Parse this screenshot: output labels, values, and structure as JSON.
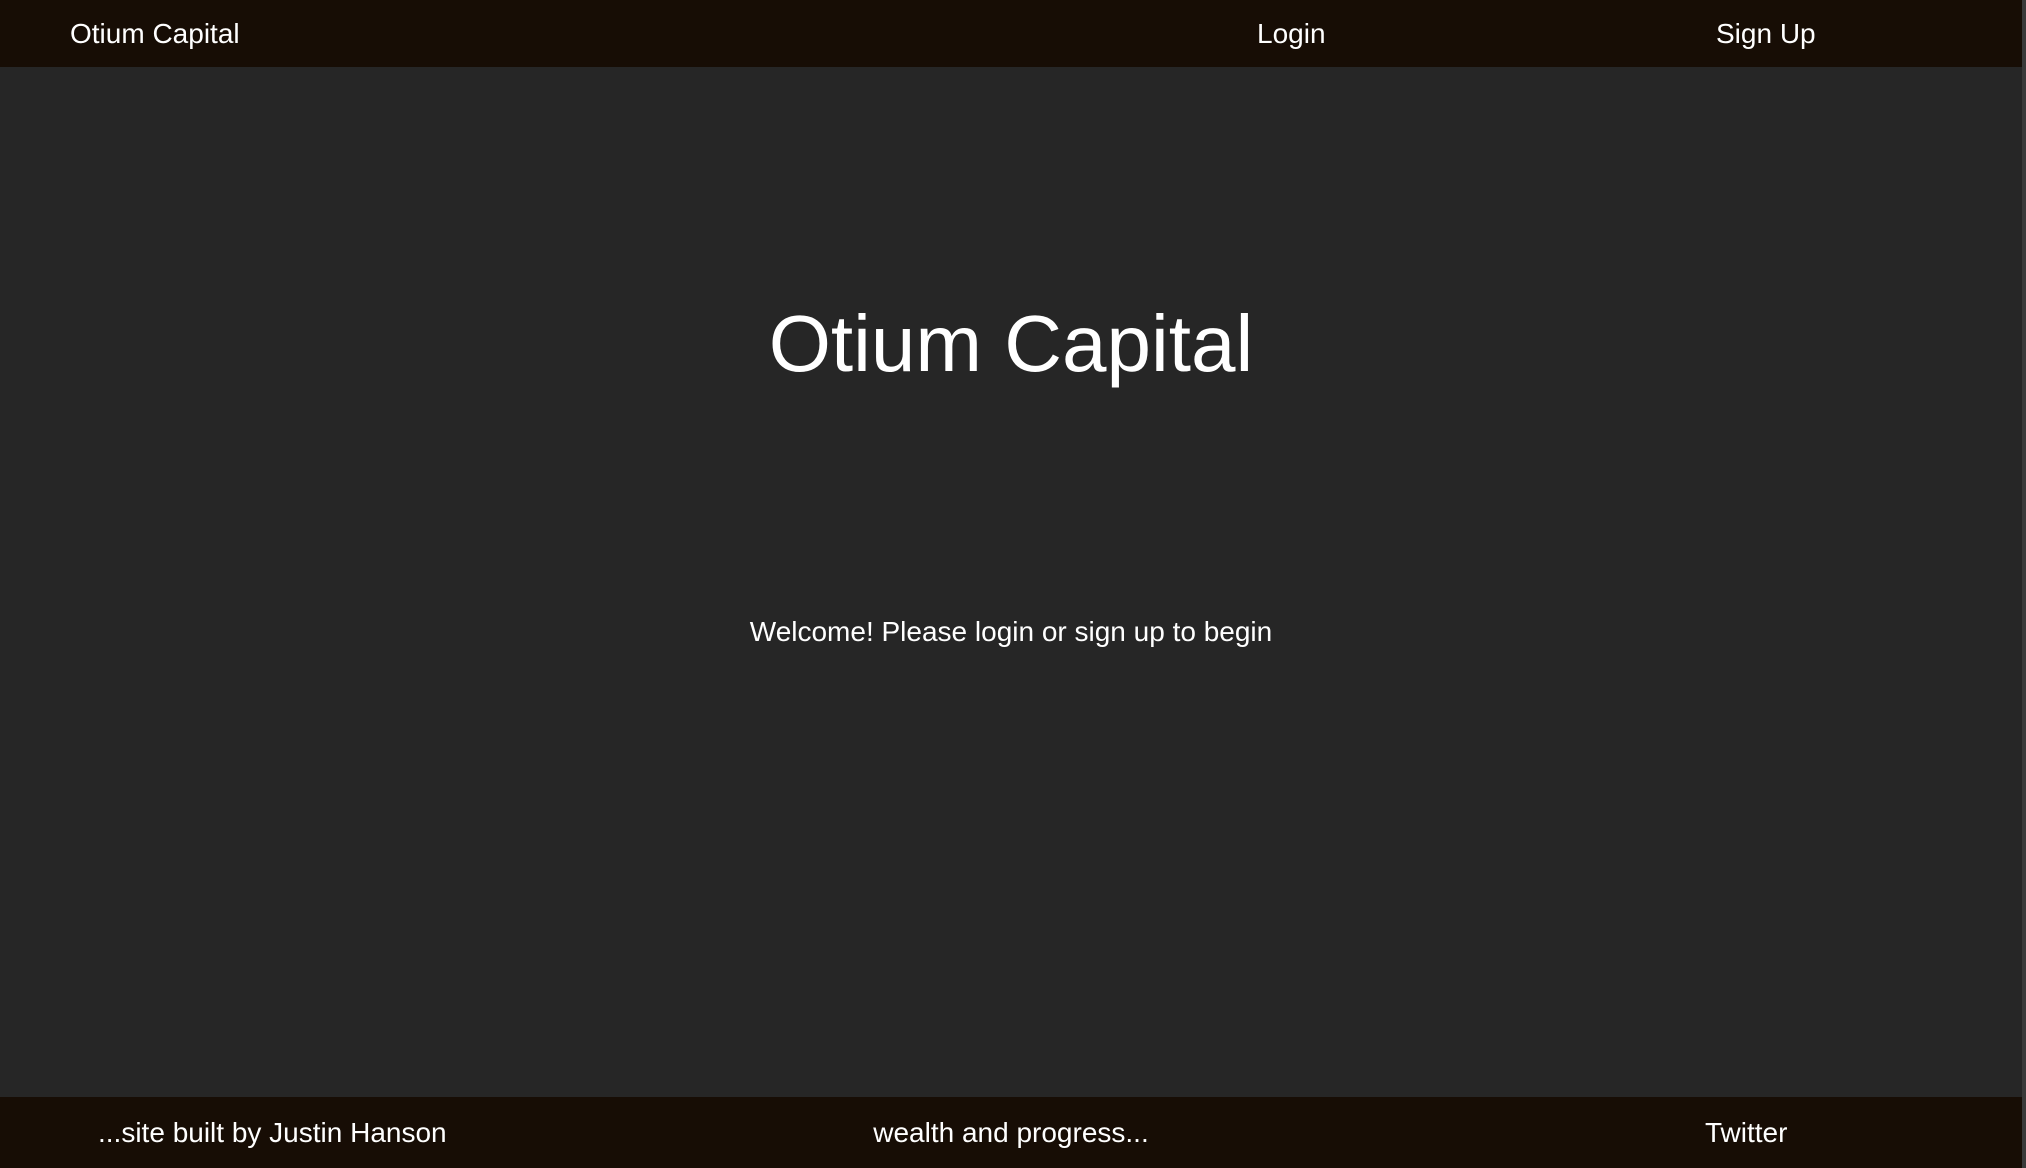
{
  "navbar": {
    "brand": "Otium Capital",
    "login_label": "Login",
    "signup_label": "Sign Up"
  },
  "main": {
    "title": "Otium Capital",
    "welcome_text": "Welcome! Please login or sign up to begin"
  },
  "footer": {
    "credit": "...site built by Justin Hanson",
    "tagline": "wealth and progress...",
    "twitter_label": "Twitter"
  },
  "colors": {
    "bar_background": "#170d05",
    "page_background": "#262626",
    "text": "#ffffff"
  }
}
